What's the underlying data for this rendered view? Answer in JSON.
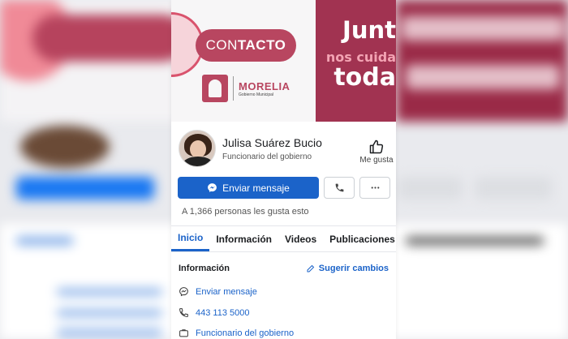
{
  "cover": {
    "badge_light": "CON",
    "badge_bold": "TACTO",
    "logo_name": "MORELIA",
    "logo_sub": "Gobierno Municipal",
    "slogan_1": "Junt",
    "slogan_2": "nos cuida",
    "slogan_3": "toda",
    "colors": {
      "brand": "#b84660",
      "dark": "#a13351",
      "pink": "#f3a3b3"
    }
  },
  "profile": {
    "name": "Julisa Suárez Bucio",
    "role": "Funcionario del gobierno",
    "like_label": "Me gusta"
  },
  "actions": {
    "message_label": "Enviar mensaje",
    "accent": "#1b63c9"
  },
  "likes_text": "A 1,366 personas les gusta esto",
  "tabs": [
    {
      "label": "Inicio",
      "active": true
    },
    {
      "label": "Información",
      "active": false
    },
    {
      "label": "Videos",
      "active": false
    },
    {
      "label": "Publicaciones",
      "active": false
    }
  ],
  "info": {
    "heading": "Información",
    "suggest_label": "Sugerir cambios",
    "rows": [
      {
        "icon": "messenger-icon",
        "text": "Enviar mensaje"
      },
      {
        "icon": "phone-icon",
        "text": "443 113 5000"
      },
      {
        "icon": "briefcase-icon",
        "text": "Funcionario del gobierno"
      }
    ]
  }
}
